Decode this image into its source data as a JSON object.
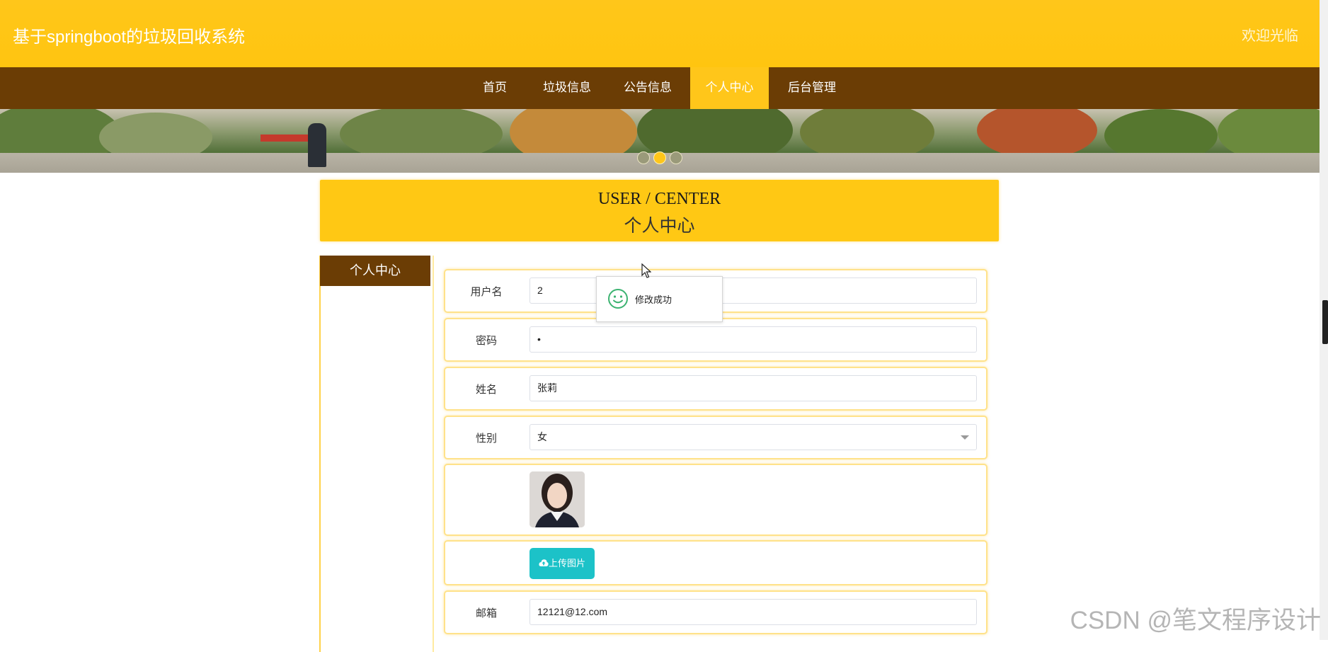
{
  "header": {
    "site_title": "基于springboot的垃圾回收系统",
    "welcome": "欢迎光临"
  },
  "nav": {
    "items": [
      {
        "label": "首页"
      },
      {
        "label": "垃圾信息"
      },
      {
        "label": "公告信息"
      },
      {
        "label": "个人中心"
      },
      {
        "label": "后台管理"
      }
    ],
    "active_index": 3
  },
  "carousel": {
    "slides": 3,
    "active_index": 1
  },
  "section": {
    "title_en": "USER / CENTER",
    "title_cn": "个人中心"
  },
  "sidebar": {
    "items": [
      {
        "label": "个人中心"
      }
    ]
  },
  "form": {
    "username": {
      "label": "用户名",
      "value": "2"
    },
    "password": {
      "label": "密码",
      "value": "•"
    },
    "name": {
      "label": "姓名",
      "value": "张莉"
    },
    "gender": {
      "label": "性别",
      "value": "女"
    },
    "photo": {
      "label": ""
    },
    "upload": {
      "label": "上传图片"
    },
    "email": {
      "label": "邮箱",
      "value": "12121@12.com"
    }
  },
  "toast": {
    "message": "修改成功"
  },
  "watermark": "CSDN @笔文程序设计",
  "colors": {
    "primary_yellow": "#ffc61a",
    "nav_brown": "#6b3d05",
    "upload_teal": "#1cc2c8",
    "toast_icon_green": "#3cb371"
  }
}
